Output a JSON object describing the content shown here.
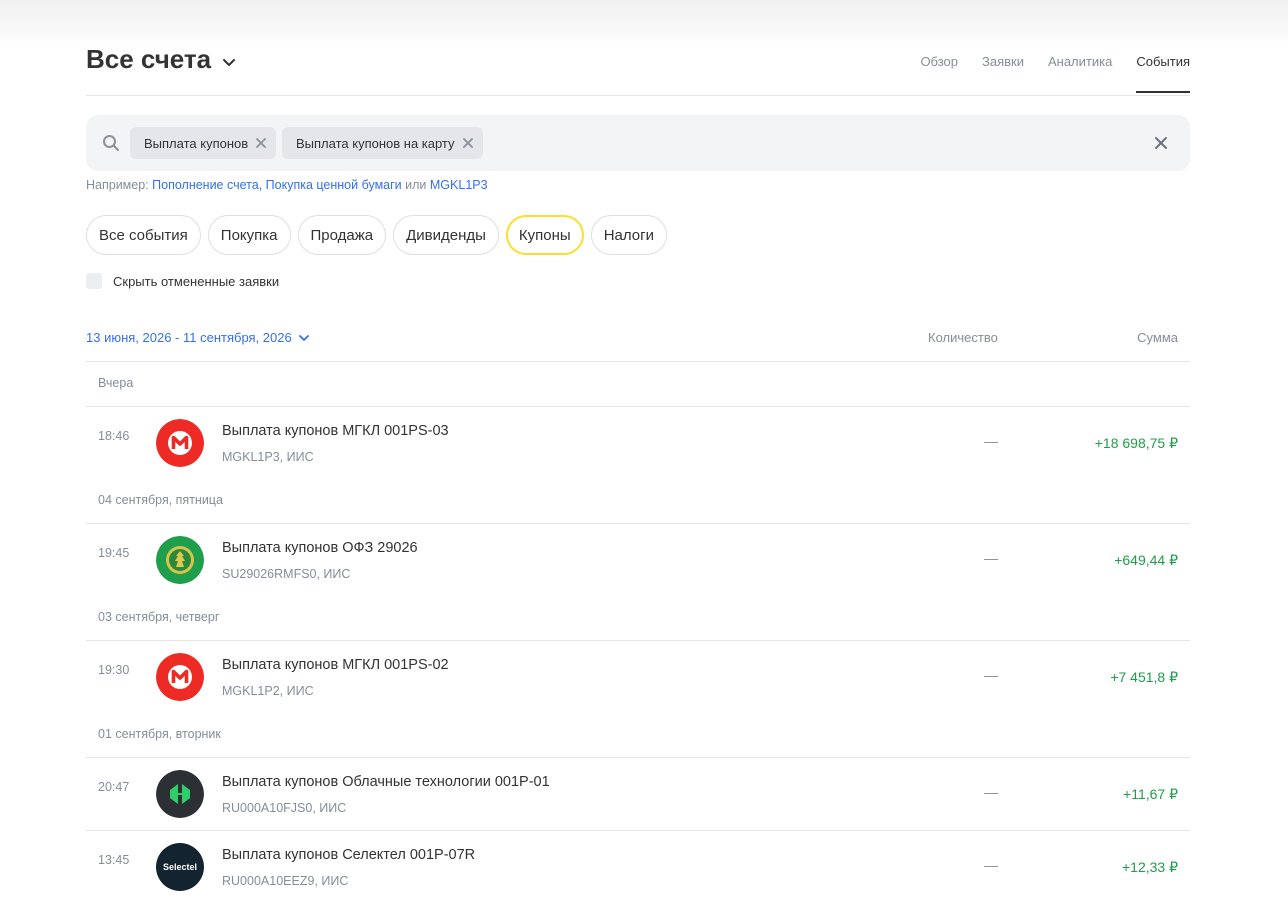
{
  "header": {
    "title": "Все счета",
    "tabs": [
      {
        "label": "Обзор",
        "active": false
      },
      {
        "label": "Заявки",
        "active": false
      },
      {
        "label": "Аналитика",
        "active": false
      },
      {
        "label": "События",
        "active": true
      }
    ]
  },
  "search": {
    "icon": "search-icon",
    "tags": [
      "Выплата купонов",
      "Выплата купонов на карту"
    ],
    "clear_icon": "close-icon"
  },
  "hint": {
    "prefix": "Например:",
    "example1": "Пополнение счета",
    "comma": ",",
    "example2": "Покупка ценной бумаги",
    "or": "или",
    "example3": "MGKL1P3"
  },
  "filters": [
    {
      "label": "Все события",
      "active": false
    },
    {
      "label": "Покупка",
      "active": false
    },
    {
      "label": "Продажа",
      "active": false
    },
    {
      "label": "Дивиденды",
      "active": false
    },
    {
      "label": "Купоны",
      "active": true
    },
    {
      "label": "Налоги",
      "active": false
    }
  ],
  "hide_cancelled": {
    "label": "Скрыть отмененные заявки",
    "checked": false
  },
  "table": {
    "date_range": "13 июня, 2026 - 11 сентября, 2026",
    "col_qty": "Количество",
    "col_sum": "Сумма"
  },
  "groups": [
    {
      "label": "Вчера",
      "rows": [
        {
          "time": "18:46",
          "logo": "mgkl-logo",
          "name": "Выплата купонов МГКЛ 001PS-03",
          "sub": "MGKL1P3, ИИС",
          "qty": "—",
          "sum": "+18 698,75 ₽"
        }
      ]
    },
    {
      "label": "04 сентября, пятница",
      "rows": [
        {
          "time": "19:45",
          "logo": "ofz-logo",
          "name": "Выплата купонов ОФЗ 29026",
          "sub": "SU29026RMFS0, ИИС",
          "qty": "—",
          "sum": "+649,44 ₽"
        }
      ]
    },
    {
      "label": "03 сентября, четверг",
      "rows": [
        {
          "time": "19:30",
          "logo": "mgkl-logo",
          "name": "Выплата купонов МГКЛ 001PS-02",
          "sub": "MGKL1P2, ИИС",
          "qty": "—",
          "sum": "+7 451,8 ₽"
        }
      ]
    },
    {
      "label": "01 сентября, вторник",
      "rows": [
        {
          "time": "20:47",
          "logo": "cloud-tech-logo",
          "name": "Выплата купонов Облачные технологии 001P-01",
          "sub": "RU000A10FJS0, ИИС",
          "qty": "—",
          "sum": "+11,67 ₽"
        },
        {
          "time": "13:45",
          "logo": "selectel-logo",
          "logo_text": "Selectel",
          "name": "Выплата купонов Селектел 001P-07R",
          "sub": "RU000A10EEZ9, ИИС",
          "qty": "—",
          "sum": "+12,33 ₽"
        }
      ]
    }
  ],
  "colors": {
    "accent_link": "#336fee",
    "positive": "#1e9e4a",
    "active_pill_border": "#ffdd2d",
    "mgkl_red": "#ee2a24",
    "ofz_green": "#1f9e4b",
    "cloud_dark": "#2c2f33",
    "selectel_navy": "#13232f"
  }
}
